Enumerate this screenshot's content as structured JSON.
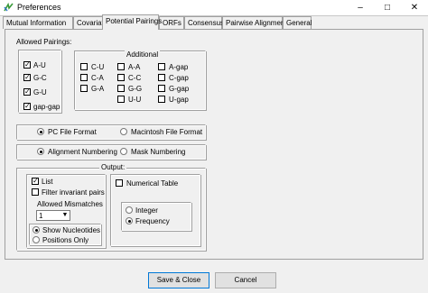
{
  "window": {
    "title": "Preferences",
    "icon": "app-logo-icon"
  },
  "tabs": [
    {
      "label": "Mutual Information"
    },
    {
      "label": "Covariation"
    },
    {
      "label": "Potential Pairings",
      "active": true
    },
    {
      "label": "ORFs"
    },
    {
      "label": "Consensus"
    },
    {
      "label": "Pairwise Alignment"
    },
    {
      "label": "General"
    }
  ],
  "allowed_pairings": {
    "label": "Allowed Pairings:",
    "primary": [
      {
        "label": "A-U",
        "checked": true
      },
      {
        "label": "G-C",
        "checked": true
      },
      {
        "label": "G-U",
        "checked": true
      },
      {
        "label": "gap-gap",
        "checked": true
      }
    ],
    "additional_label": "Additional",
    "additional": [
      {
        "label": "C-U",
        "checked": false
      },
      {
        "label": "C-A",
        "checked": false
      },
      {
        "label": "G-A",
        "checked": false
      },
      {
        "label": "A-A",
        "checked": false
      },
      {
        "label": "C-C",
        "checked": false
      },
      {
        "label": "G-G",
        "checked": false
      },
      {
        "label": "U-U",
        "checked": false
      },
      {
        "label": "A-gap",
        "checked": false
      },
      {
        "label": "C-gap",
        "checked": false
      },
      {
        "label": "G-gap",
        "checked": false
      },
      {
        "label": "U-gap",
        "checked": false
      }
    ]
  },
  "file_format": {
    "pc": {
      "label": "PC File Format",
      "selected": true
    },
    "mac": {
      "label": "Macintosh File Format",
      "selected": false
    }
  },
  "numbering": {
    "alignment": {
      "label": "Alignment Numbering",
      "selected": true
    },
    "mask": {
      "label": "Mask Numbering",
      "selected": false
    }
  },
  "output": {
    "label": "Output:",
    "list": {
      "label": "List",
      "checked": true
    },
    "filter_invariant": {
      "label": "Filter invariant pairs",
      "checked": false
    },
    "allowed_mismatches_label": "Allowed Mismatches",
    "allowed_mismatches_value": "1",
    "show_nucleotides": {
      "label": "Show Nucleotides",
      "selected": true
    },
    "positions_only": {
      "label": "Positions Only",
      "selected": false
    },
    "numerical_table": {
      "label": "Numerical Table",
      "checked": false
    },
    "integer": {
      "label": "Integer",
      "selected": false
    },
    "frequency": {
      "label": "Frequency",
      "selected": true
    }
  },
  "buttons": {
    "save_close": "Save & Close",
    "cancel": "Cancel"
  },
  "colors": {
    "accent": "#0078d7",
    "dialog_bg": "#f0f0f0",
    "border": "#a0a0a0"
  }
}
